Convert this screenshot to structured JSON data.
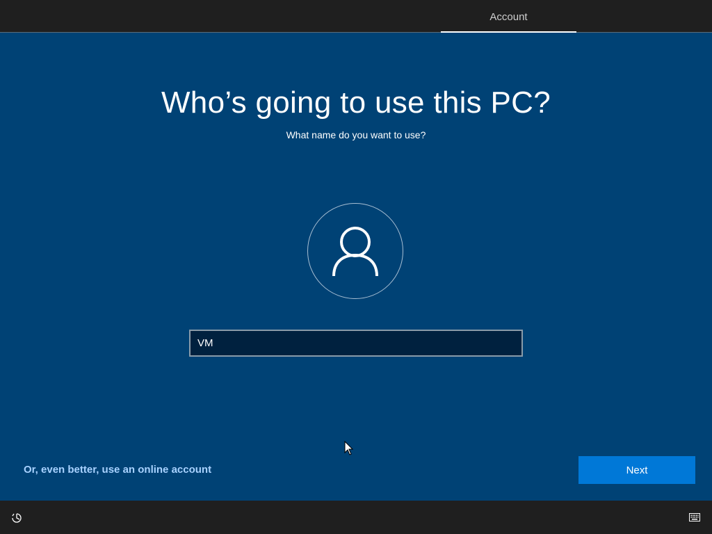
{
  "header": {
    "tabs": [
      {
        "label": "Account",
        "active": true
      }
    ]
  },
  "main": {
    "title": "Who’s going to use this PC?",
    "subtitle": "What name do you want to use?",
    "avatar_icon": "user-icon",
    "name_input": {
      "value": "VM",
      "placeholder": ""
    },
    "online_account_link": "Or, even better, use an online account",
    "next_label": "Next"
  },
  "footer": {
    "left_icon": "ease-of-access-icon",
    "right_icon": "keyboard-icon"
  },
  "colors": {
    "background": "#004275",
    "top_bar": "#1f1f1f",
    "accent": "#0078d7",
    "link": "#a8d2ff",
    "input_bg": "#00213f"
  }
}
